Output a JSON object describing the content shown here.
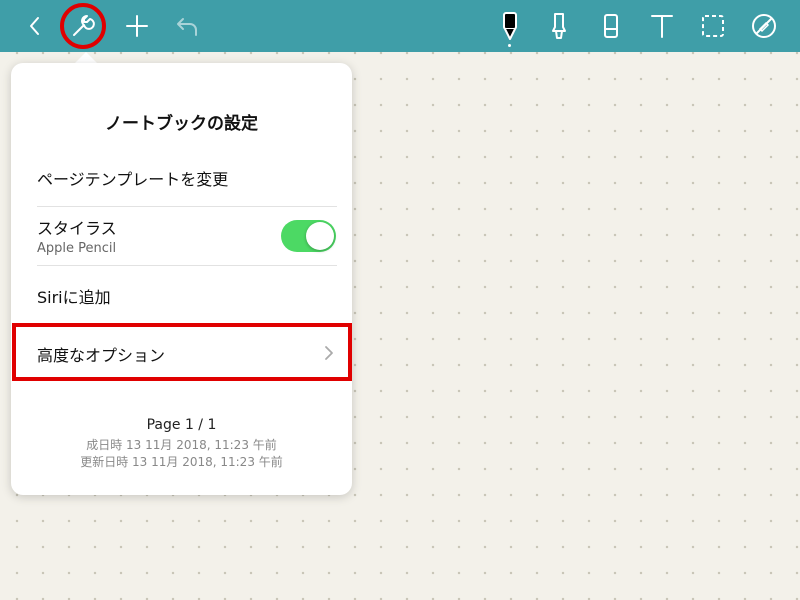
{
  "toolbar": {
    "icons": [
      "back-icon",
      "wrench-icon",
      "plus-icon",
      "undo-icon",
      "pen-icon",
      "highlighter-icon",
      "eraser-icon",
      "text-icon",
      "lasso-icon",
      "disable-touch-icon"
    ]
  },
  "popover": {
    "title": "ノートブックの設定",
    "change_template": "ページテンプレートを変更",
    "stylus_label": "スタイラス",
    "stylus_sub": "Apple Pencil",
    "stylus_enabled": true,
    "siri": "Siriに追加",
    "advanced": "高度なオプション",
    "page_info": "Page 1 / 1",
    "created": "成日時 13 11月 2018, 11:23 午前",
    "updated": "更新日時 13 11月 2018, 11:23 午前"
  },
  "colors": {
    "toolbar": "#3f9ea8",
    "toggle_on": "#4cd964",
    "highlight": "#e00000"
  }
}
